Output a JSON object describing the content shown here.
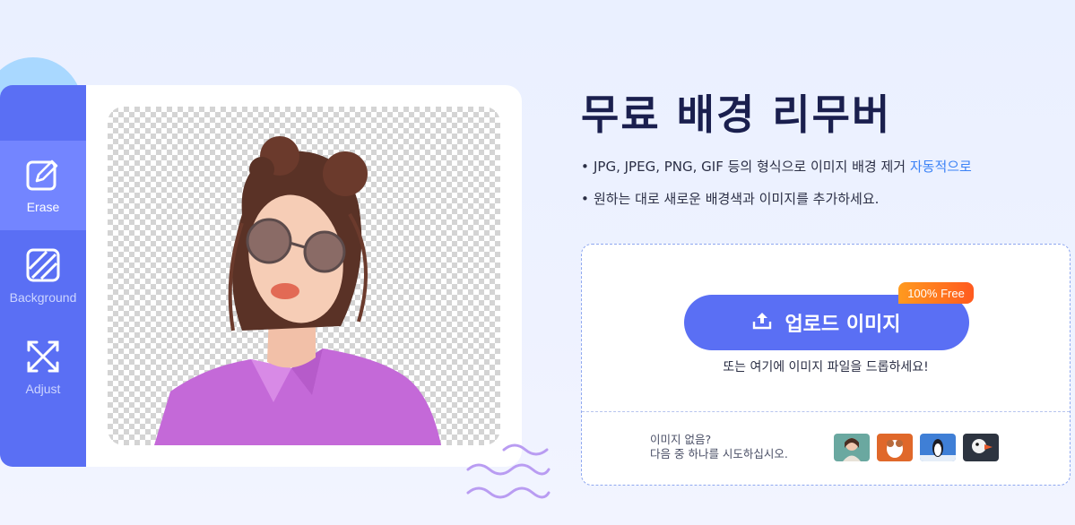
{
  "tools": [
    {
      "label": "Erase",
      "icon": "edit-box-icon",
      "active": true
    },
    {
      "label": "Background",
      "icon": "striped-square-icon",
      "active": false
    },
    {
      "label": "Adjust",
      "icon": "resize-arrows-icon",
      "active": false
    }
  ],
  "preview": {
    "subject": "woman-with-sunglasses-cutout"
  },
  "hero": {
    "title": "무료 배경 리무버",
    "features": [
      {
        "text": "JPG, JPEG, PNG, GIF 등의 형식으로 이미지 배경 제거 ",
        "highlight": "자동적으로"
      },
      {
        "text": "원하는 대로 새로운 배경색과 이미지를 추가하세요.",
        "highlight": ""
      }
    ]
  },
  "upload": {
    "button_label": "업로드 이미지",
    "badge": "100% Free",
    "drop_hint": "또는 여기에 이미지 파일을 드롭하세요!",
    "no_image_line1": "이미지 없음?",
    "no_image_line2": "다음 중 하나를 시도하십시오.",
    "samples": [
      "portrait-sample",
      "dog-sample",
      "penguin-sample",
      "puffin-sample"
    ]
  },
  "colors": {
    "accent": "#5a6ff4",
    "accent_active": "#7385ff",
    "title": "#1a1f4e",
    "highlight": "#3b82f6",
    "badge": "#ff7a1f"
  }
}
